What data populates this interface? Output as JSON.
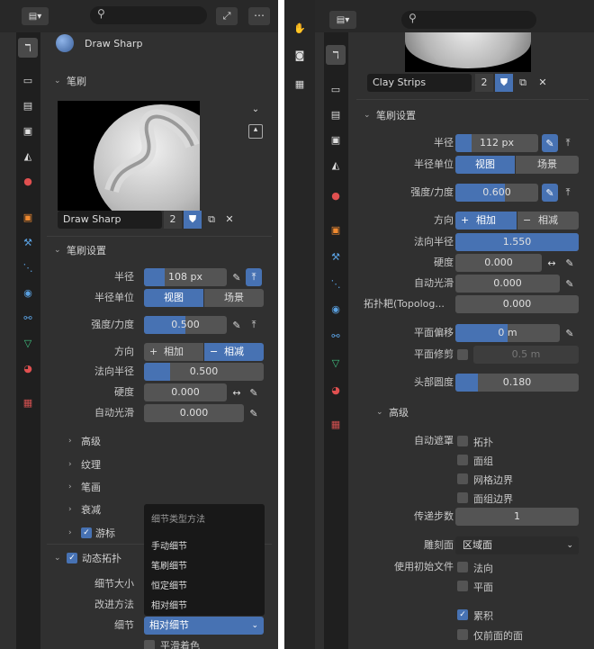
{
  "left": {
    "brush_name": "Draw Sharp",
    "brush_users": "2",
    "sections": {
      "brush": "笔刷",
      "brush_settings": "笔刷设置"
    },
    "radius": {
      "label": "半径",
      "value": "108 px",
      "fill": 0.25
    },
    "radius_unit": {
      "label": "半径单位",
      "view": "视图",
      "scene": "场景"
    },
    "strength": {
      "label": "强度/力度",
      "value": "0.500",
      "fill": 0.5
    },
    "direction": {
      "label": "方向",
      "add": "相加",
      "sub": "相减"
    },
    "normal_radius": {
      "label": "法向半径",
      "value": "0.500",
      "fill": 0.22
    },
    "hardness": {
      "label": "硬度",
      "value": "0.000"
    },
    "auto_smooth": {
      "label": "自动光滑",
      "value": "0.000"
    },
    "subpanels": [
      "高级",
      "纹理",
      "笔画",
      "衰减"
    ],
    "cursor": "游标",
    "dyntopo": "动态拓扑",
    "detail_size": "细节大小",
    "refine_method": "改进方法",
    "detailing": {
      "label": "细节",
      "value": "相对细节"
    },
    "smooth_shading": "平滑着色",
    "menu": {
      "title": "细节类型方法",
      "items": [
        "手动细节",
        "笔刷细节",
        "恒定细节",
        "相对细节"
      ]
    }
  },
  "right": {
    "brush_name": "Clay Strips",
    "brush_users": "2",
    "sections": {
      "brush_settings": "笔刷设置",
      "advanced": "高级"
    },
    "radius": {
      "label": "半径",
      "value": "112 px",
      "fill": 0.2
    },
    "radius_unit": {
      "label": "半径单位",
      "view": "视图",
      "scene": "场景"
    },
    "strength": {
      "label": "强度/力度",
      "value": "0.600",
      "fill": 0.6
    },
    "direction": {
      "label": "方向",
      "add": "相加",
      "sub": "相减"
    },
    "normal_radius": {
      "label": "法向半径",
      "value": "1.550",
      "fill": 1.0
    },
    "hardness": {
      "label": "硬度",
      "value": "0.000"
    },
    "auto_smooth": {
      "label": "自动光滑",
      "value": "0.000"
    },
    "topology_rake": {
      "label": "拓扑耙(Topolog...",
      "value": "0.000"
    },
    "plane_offset": {
      "label": "平面偏移",
      "value": "0 m",
      "fill": 0.5
    },
    "plane_trim": {
      "label": "平面修剪",
      "value": "0.5 m"
    },
    "tip_roundness": {
      "label": "头部圆度",
      "value": "0.180",
      "fill": 0.18
    },
    "auto_mask": {
      "label": "自动遮罩",
      "options": [
        "拓扑",
        "面组",
        "网格边界",
        "面组边界"
      ]
    },
    "propagation_steps": {
      "label": "传递步数",
      "value": "1"
    },
    "sculpt_plane": {
      "label": "雕刻面",
      "value": "区域面"
    },
    "use_original": {
      "label": "使用初始文件",
      "options": [
        "法向",
        "平面"
      ]
    },
    "accumulate": "累积",
    "front_faces_only": "仅前面的面"
  },
  "colors": {
    "accent": "#4772b3",
    "panel": "#303030",
    "field": "#545454",
    "tabbar": "#1f1f1f"
  }
}
